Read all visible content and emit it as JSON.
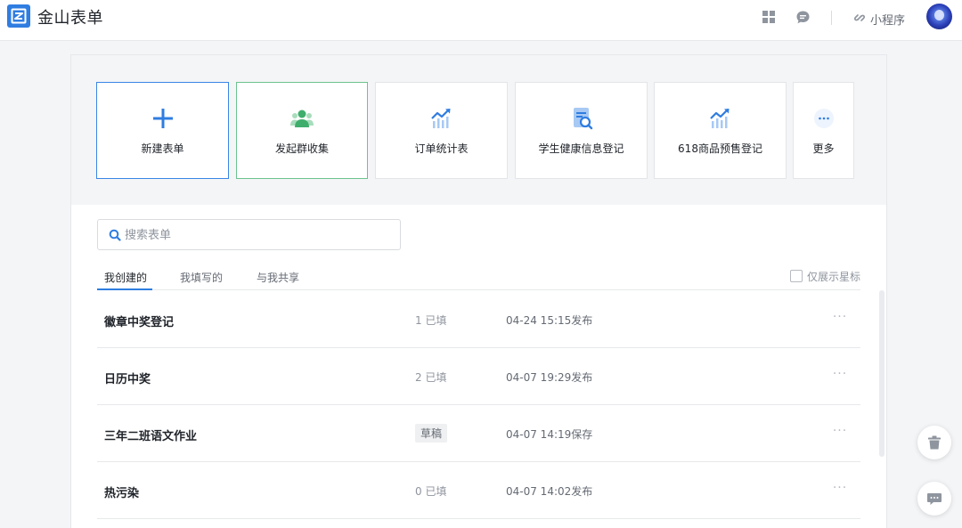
{
  "app": {
    "name": "金山表单",
    "brand_color": "#2f7de1"
  },
  "header": {
    "grid_icon": "grid-icon",
    "message_icon": "message-icon",
    "mini_program_label": "小程序",
    "mini_program_icon": "link-icon"
  },
  "templates": [
    {
      "label": "新建表单",
      "icon": "plus-icon"
    },
    {
      "label": "发起群收集",
      "icon": "group-icon"
    },
    {
      "label": "订单统计表",
      "icon": "chart-trend-icon"
    },
    {
      "label": "学生健康信息登记",
      "icon": "form-search-icon"
    },
    {
      "label": "618商品预售登记",
      "icon": "chart-trend-icon"
    },
    {
      "label": "更多",
      "icon": "more-icon"
    }
  ],
  "search": {
    "placeholder": "搜索表单",
    "value": ""
  },
  "tabs": {
    "items": [
      {
        "label": "我创建的",
        "active": true
      },
      {
        "label": "我填写的",
        "active": false
      },
      {
        "label": "与我共享",
        "active": false
      }
    ],
    "star_filter_label": "仅展示星标",
    "star_filter_checked": false
  },
  "forms": [
    {
      "title": "徽章中奖登记",
      "status": "1 已填",
      "time": "04-24 15:15发布"
    },
    {
      "title": "日历中奖",
      "status": "2 已填",
      "time": "04-07 19:29发布"
    },
    {
      "title": "三年二班语文作业",
      "status": "草稿",
      "time": "04-07 14:19保存"
    },
    {
      "title": "热污染",
      "status": "0 已填",
      "time": "04-07 14:02发布"
    }
  ],
  "more_label": "···",
  "fabs": {
    "trash_icon": "trash-icon",
    "feedback_icon": "feedback-icon"
  }
}
